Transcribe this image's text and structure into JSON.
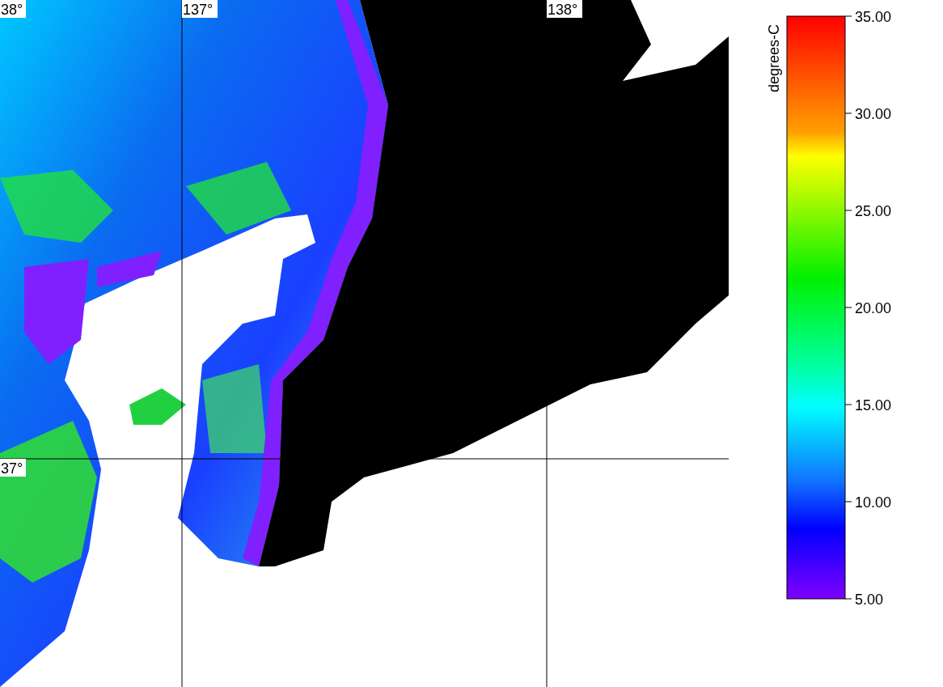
{
  "map": {
    "lat_labels": [
      {
        "text": "38°",
        "kind": "top"
      },
      {
        "text": "37°",
        "kind": "middle"
      }
    ],
    "lon_labels": [
      "137°",
      "138°"
    ]
  },
  "colorbar": {
    "unit": "degrees-C",
    "ticks": [
      "35.00",
      "30.00",
      "25.00",
      "20.00",
      "15.00",
      "10.00",
      "5.00"
    ]
  }
}
